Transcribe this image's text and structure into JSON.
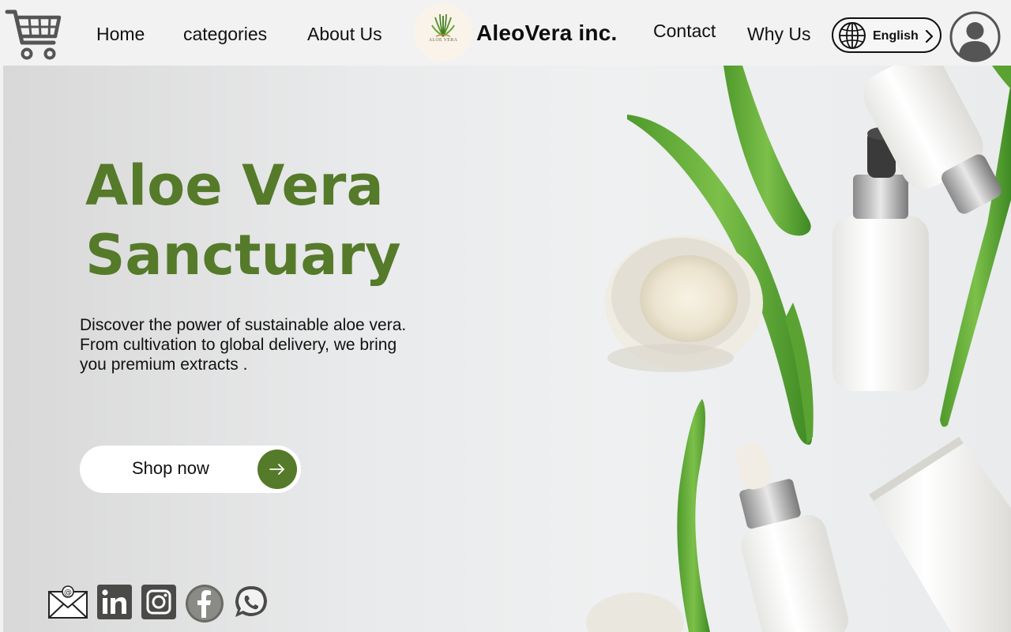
{
  "header": {
    "cart_icon": "shopping-cart-icon",
    "nav": {
      "home": "Home",
      "categories": "categories",
      "about": "About Us",
      "contact": "Contact",
      "why": "Why Us"
    },
    "logo_text": "ALOE VERA",
    "brand": "AleoVera inc.",
    "language": "English",
    "language_icon": "globe-icon",
    "profile_icon": "user-avatar-icon"
  },
  "hero": {
    "title_line1": "Aloe Vera",
    "title_line2": "Sanctuary",
    "description": "Discover the power of sustainable aloe vera. From cultivation to global delivery, we bring you premium extracts .",
    "cta_label": "Shop now",
    "cta_icon": "arrow-right-icon"
  },
  "social": [
    "email-icon",
    "linkedin-icon",
    "instagram-icon",
    "facebook-icon",
    "whatsapp-icon"
  ],
  "colors": {
    "brand_green": "#557a2a",
    "header_bg": "#f2f2f2",
    "text_dark": "#111111"
  }
}
